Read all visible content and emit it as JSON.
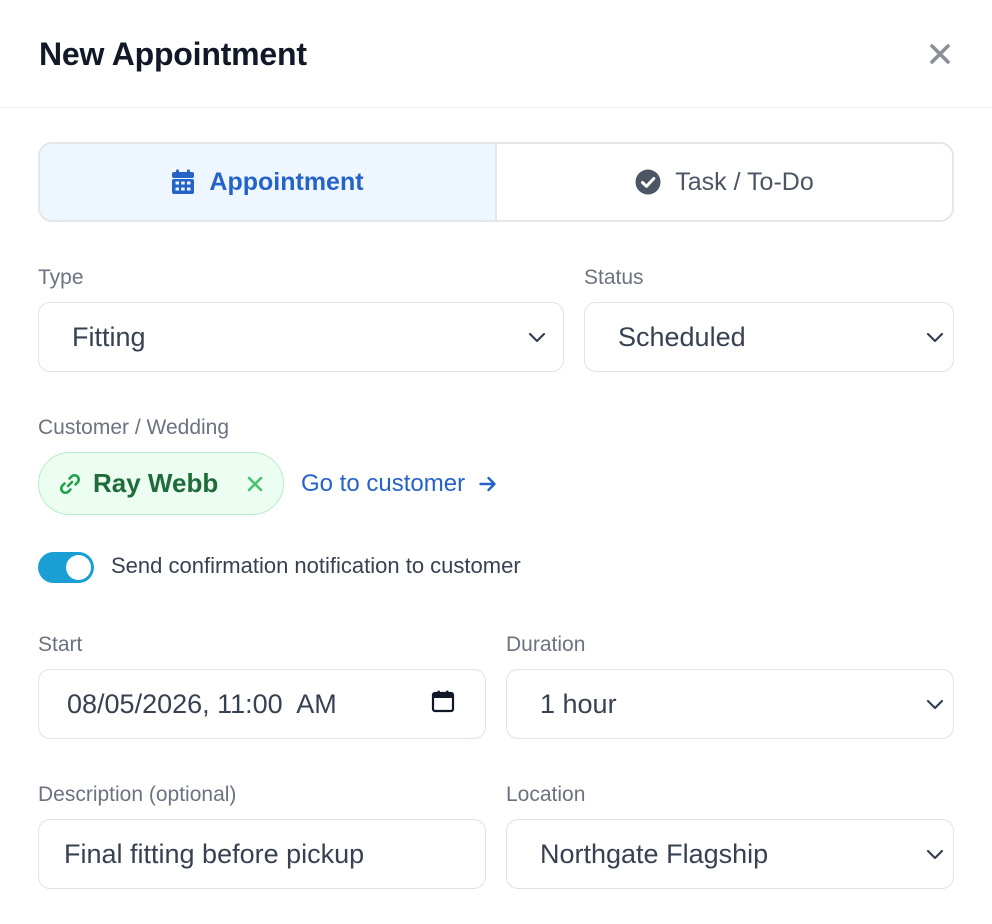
{
  "header": {
    "title": "New Appointment"
  },
  "tabs": {
    "appointment": "Appointment",
    "task": "Task / To-Do"
  },
  "type": {
    "label": "Type",
    "value": "Fitting"
  },
  "status": {
    "label": "Status",
    "value": "Scheduled"
  },
  "customer": {
    "label": "Customer / Wedding",
    "name": "Ray Webb",
    "goto_label": "Go to customer"
  },
  "notification": {
    "label": "Send confirmation notification to customer",
    "enabled": true
  },
  "start": {
    "label": "Start",
    "value": "08/05/2026, 11:00  AM"
  },
  "duration": {
    "label": "Duration",
    "value": "1 hour"
  },
  "description": {
    "label": "Description (optional)",
    "value": "Final fitting before pickup"
  },
  "location": {
    "label": "Location",
    "value": "Northgate Flagship"
  },
  "colors": {
    "accent": "#2563c9",
    "toggle": "#1a9fd4",
    "chip_bg": "#ecfdf1",
    "chip_text": "#1f6b3a"
  }
}
